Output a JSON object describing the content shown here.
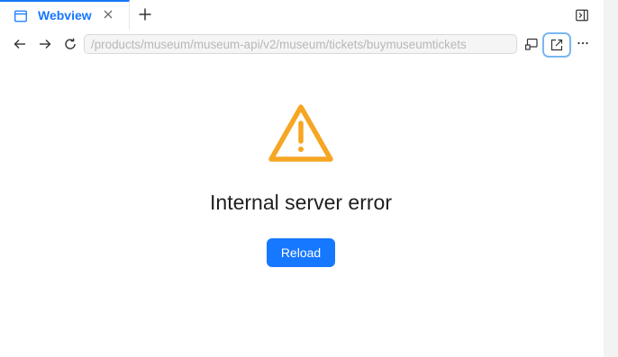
{
  "tabbar": {
    "active_tab": {
      "label": "Webview",
      "icon": "browser-window-icon"
    },
    "close_icon": "close-icon",
    "new_tab_icon": "plus-icon",
    "panel_toggle_icon": "panel-collapse-icon"
  },
  "navbar": {
    "back_icon": "arrow-left-icon",
    "forward_icon": "arrow-right-icon",
    "reload_icon": "refresh-icon",
    "url": "/products/museum/museum-api/v2/museum/tickets/buymuseumtickets",
    "cast_icon": "cast-icon",
    "open_external_icon": "external-link-icon",
    "more_icon": "ellipsis-icon"
  },
  "content": {
    "error_title": "Internal server error",
    "reload_label": "Reload",
    "warning_icon": "warning-triangle-icon"
  },
  "colors": {
    "accent": "#1677ff",
    "warning": "#f6a623",
    "focus_ring": "#7ab6ef"
  }
}
